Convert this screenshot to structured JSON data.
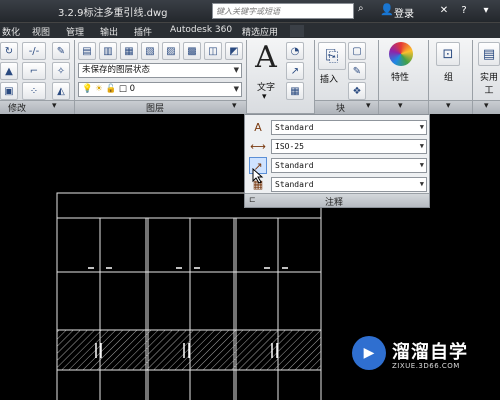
{
  "titlebar": {
    "title": "3.2.9标注多重引线.dwg",
    "search_placeholder": "键入关键字或短语",
    "login": "登录"
  },
  "menu": {
    "items": [
      "数化",
      "视图",
      "管理",
      "输出",
      "插件",
      "Autodesk 360",
      "精选应用"
    ]
  },
  "ribbon": {
    "modify_label": "修改",
    "layers_label": "图层",
    "block_label": "块",
    "layer_state": "未保存的图层状态",
    "layer_current": "0",
    "text_label": "文字",
    "insert_label": "插入",
    "properties_label": "特性",
    "group_label": "组",
    "utilities_label": "实用工"
  },
  "annotation": {
    "title": "注释",
    "text_style": "Standard",
    "dim_style": "ISO-25",
    "mleader_style": "Standard",
    "table_style": "Standard"
  },
  "watermark": {
    "brand": "溜溜自学",
    "url": "ZIXUE.3D66.COM"
  }
}
